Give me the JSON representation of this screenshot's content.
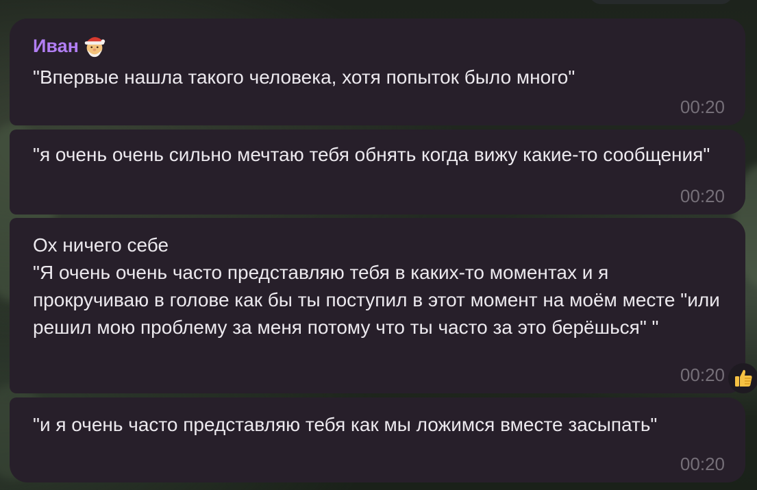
{
  "chat": {
    "messages": [
      {
        "sender": "Иван",
        "sender_icon": "santa-hat-emoji-icon",
        "text": "\"Впервые нашла такого человека, хотя попыток было много\"",
        "time": "00:20"
      },
      {
        "text": "\"я очень очень сильно мечтаю тебя обнять когда вижу какие-то сообщения\"",
        "time": "00:20"
      },
      {
        "text": "Ох ничего себе\n\"Я очень очень часто представляю тебя в каких-то моментах и я прокручиваю в голове как бы ты поступил в этот момент на моём месте \"или решил мою проблему за меня потому что ты часто за это берёшься\" \"",
        "time": "00:20",
        "reaction": "thumbs-up-icon"
      },
      {
        "text": "\"и я очень часто представляю тебя как мы ложимся вместе засыпать\"",
        "time": "00:20"
      }
    ]
  },
  "colors": {
    "bubble_bg": "#271f2a",
    "sender_name": "#b17ef3",
    "text": "#ece9ee",
    "timestamp": "#756f78"
  }
}
